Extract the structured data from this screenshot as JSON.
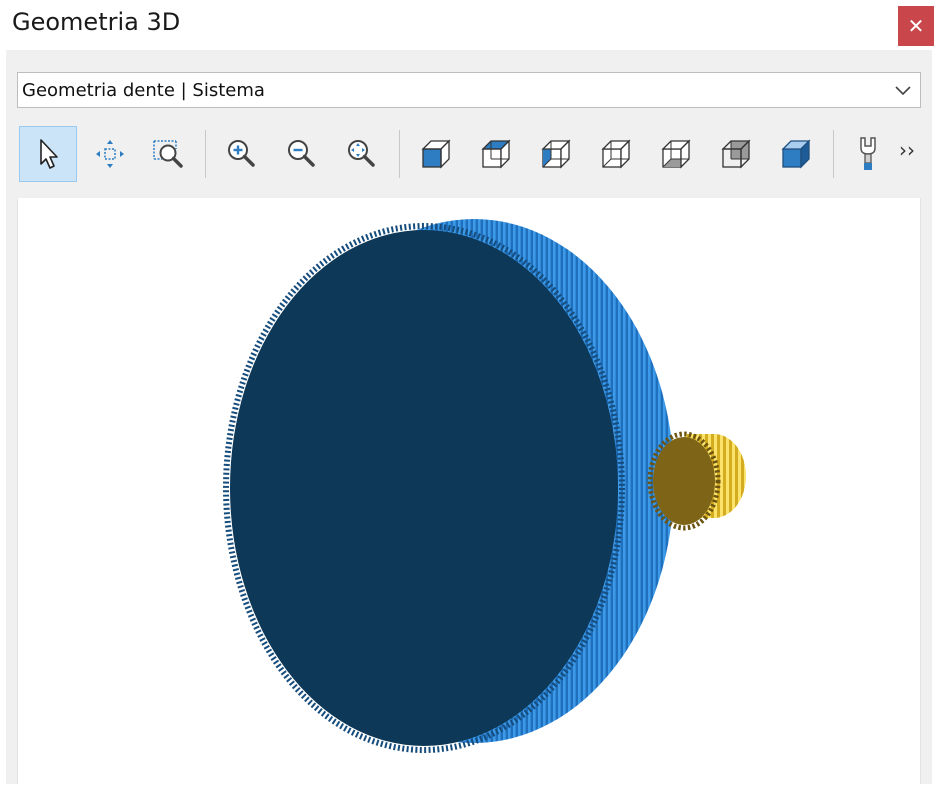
{
  "window": {
    "title": "Geometria 3D",
    "close_label": "✕"
  },
  "selector": {
    "value": "Geometria dente | Sistema"
  },
  "toolbar": {
    "tools": [
      {
        "icon": "select-pointer-icon",
        "active": true
      },
      {
        "icon": "pan-icon",
        "active": false
      },
      {
        "icon": "zoom-window-icon",
        "active": false
      },
      {
        "icon": "zoom-in-icon",
        "active": false
      },
      {
        "icon": "zoom-out-icon",
        "active": false
      },
      {
        "icon": "zoom-extents-icon",
        "active": false
      },
      {
        "icon": "view-front-icon",
        "active": false
      },
      {
        "icon": "view-top-icon",
        "active": false
      },
      {
        "icon": "view-left-icon",
        "active": false
      },
      {
        "icon": "view-right-icon",
        "active": false
      },
      {
        "icon": "view-bottom-icon",
        "active": false
      },
      {
        "icon": "view-back-icon",
        "active": false
      },
      {
        "icon": "view-isometric-icon",
        "active": false
      },
      {
        "icon": "settings-wrench-icon",
        "active": false
      }
    ],
    "overflow_label": "››"
  },
  "scene": {
    "gear_large_color": "#0e3857",
    "gear_large_teeth_color": "#2b86d6",
    "gear_small_color": "#7e6417",
    "gear_small_teeth_color": "#f2cf35"
  }
}
